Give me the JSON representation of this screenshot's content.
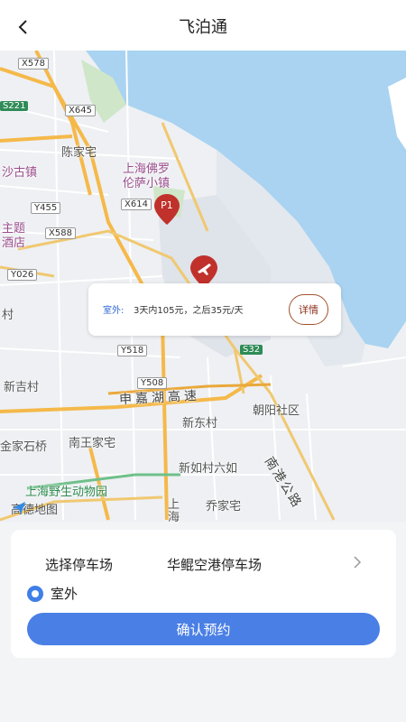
{
  "header": {
    "title": "飞泊通"
  },
  "map": {
    "labels": {
      "chenjiazhai": "陈家宅",
      "shaguzhen": "沙古镇",
      "foluo1": "上海佛罗",
      "foluo2": "伦萨小镇",
      "zhuti": "主题",
      "jiudian": "酒店",
      "cun": "村",
      "xinjicun": "新吉村",
      "xindongcun": "新东村",
      "chaoyang": "朝阳社区",
      "nanwang": "南王家宅",
      "jinjia": "金家石桥",
      "xinru": "新如村六如",
      "qiaojia": "乔家宅",
      "zoo": "上海野生动物园",
      "shanghai1": "上",
      "shanghai2": "海"
    },
    "roads": {
      "shenjia": "申嘉湖高速",
      "nangang": "南港公路"
    },
    "badges": {
      "x578": "X578",
      "s221": "S221",
      "x645": "X645",
      "y455": "Y455",
      "x614": "X614",
      "x588": "X588",
      "y026": "Y026",
      "y518": "Y518",
      "y508": "Y508",
      "s32": "S32"
    },
    "pin_p1": "P1",
    "logo": "高德地图"
  },
  "info_card": {
    "label": "室外:",
    "text": "3天内105元，之后35元/天",
    "detail": "详情"
  },
  "panel": {
    "select_label": "选择停车场",
    "select_value": "华鲲空港停车场",
    "radio_label": "室外",
    "confirm": "确认预约"
  },
  "colors": {
    "accent": "#4a7fe5",
    "pin": "#c0312b",
    "water": "#a9d3f0"
  }
}
